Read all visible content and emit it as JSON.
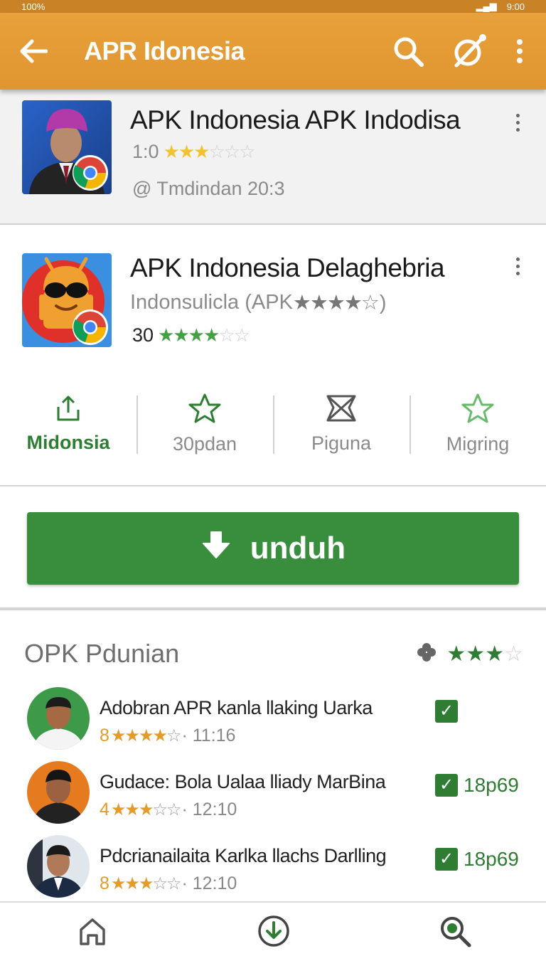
{
  "status_bar": {
    "left_text": "100%",
    "right_text": "9:00"
  },
  "app_bar": {
    "title": "APR Idonesia",
    "icons": [
      "arrow-back-icon",
      "search-icon",
      "no-ads-icon",
      "more-vert-icon"
    ]
  },
  "featured": {
    "name": "APK Indonesia APK Indodisa",
    "rating_value": "1:0",
    "stars_filled": 3,
    "stars_total": 6,
    "time_text": "@ Tmdindan 20:3"
  },
  "app": {
    "name": "APK Indonesia Delaghebria",
    "developer": "Indonsulicla (APK ",
    "developer_stars": "★★★★",
    "developer_suffix": "☆)",
    "rating_count": "30",
    "stars_filled": 4,
    "stars_total": 6
  },
  "actions": [
    {
      "label": "Midonsia",
      "icon": "share-icon",
      "active": true
    },
    {
      "label": "30pdan",
      "icon": "star-outline-icon",
      "active": false
    },
    {
      "label": "Piguna",
      "icon": "bookmark-cross-icon",
      "active": false
    },
    {
      "label": "Migring",
      "icon": "star-outline-icon",
      "active": false
    }
  ],
  "download_button": {
    "label": "unduh"
  },
  "section": {
    "title": "OPK Pdunian",
    "stars_filled": 3,
    "stars_total": 4
  },
  "list": [
    {
      "title": "Adobran APR kanla llaking Uarka",
      "rating": "8",
      "stars": 4,
      "time": "· 11:16",
      "badge": ""
    },
    {
      "title": "Gudace: Bola Ualaa lliady MarBina",
      "rating": "4",
      "stars": 3,
      "time": "· 12:10",
      "badge": "18p69"
    },
    {
      "title": "Pdcrianailaita Karlka llachs Darlling",
      "rating": "8",
      "stars": 3,
      "time": "· 12:10",
      "badge": "18p69"
    }
  ],
  "colors": {
    "app_bar": "#e8a13a",
    "primary_green": "#388e3c",
    "star_yellow": "#f1c232",
    "accent_orange": "#e69a28"
  },
  "bottom_nav": [
    "home-icon",
    "download-circle-icon",
    "search-icon"
  ]
}
